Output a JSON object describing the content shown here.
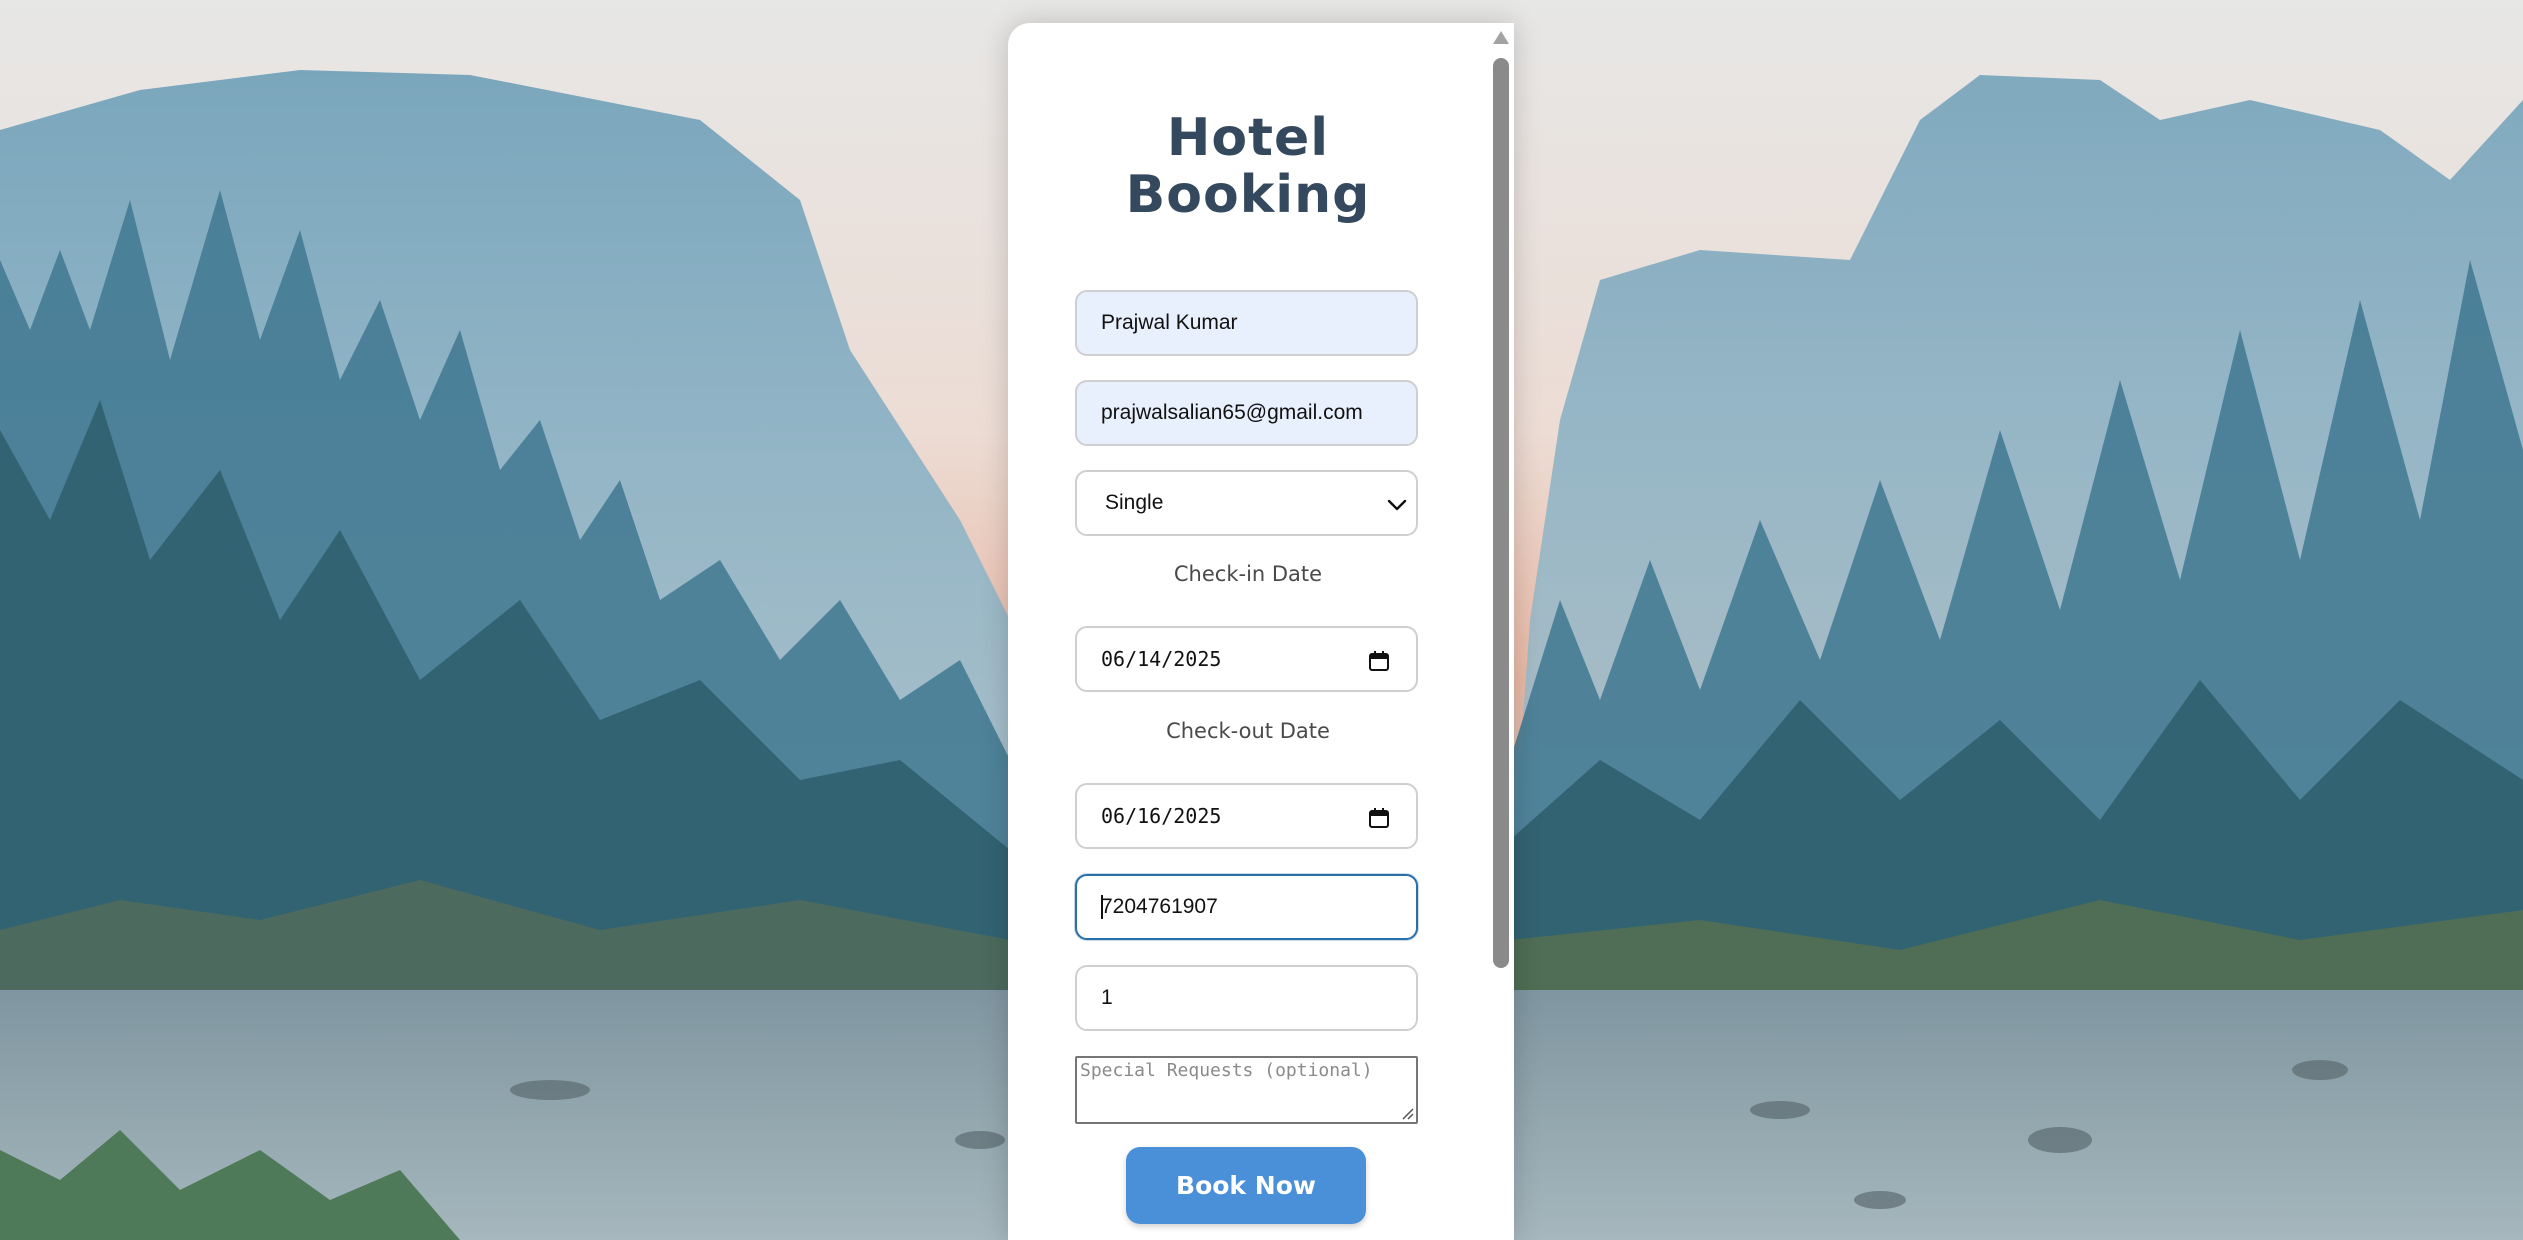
{
  "form": {
    "title": "Hotel Booking",
    "name_value": "Prajwal Kumar",
    "email_value": "prajwalsalian65@gmail.com",
    "room_type_selected": "Single",
    "checkin_label": "Check-in Date",
    "checkin_value": "06/14/2025",
    "checkout_label": "Check-out Date",
    "checkout_value": "06/16/2025",
    "phone_value": "7204761907",
    "guests_value": "1",
    "special_requests_placeholder": "Special Requests (optional)",
    "submit_label": "Book Now"
  },
  "icons": {
    "select_arrow": "chevron-down-icon",
    "date_picker": "calendar-icon",
    "textarea_resize": "resize-grip-icon"
  },
  "colors": {
    "title": "#34495e",
    "button": "#4a90d9",
    "autofill_bg": "#e8f0fe",
    "focus_border": "#2a6fa8"
  }
}
